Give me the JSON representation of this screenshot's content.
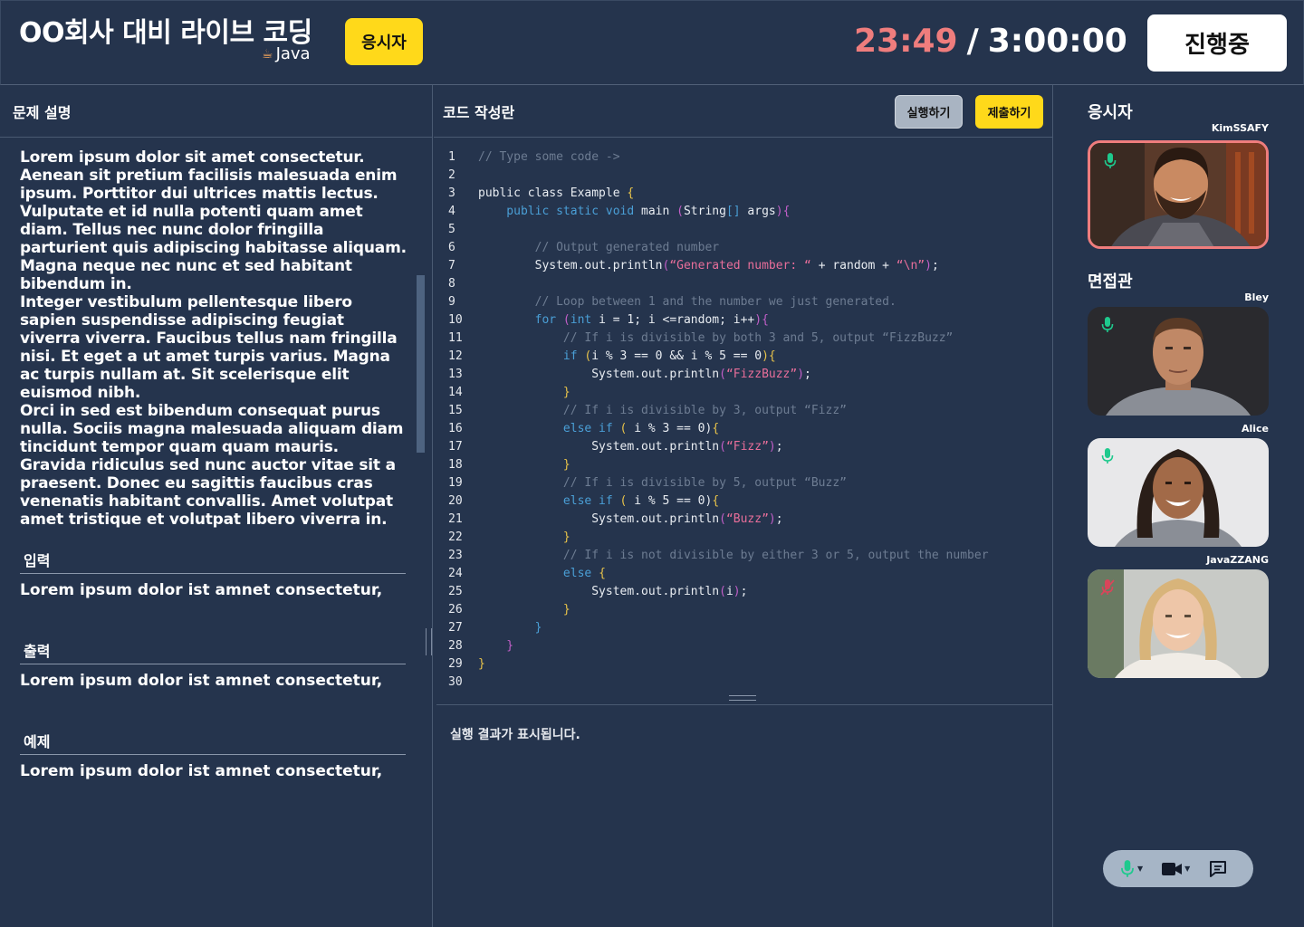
{
  "header": {
    "title": "OO회사 대비 라이브 코딩",
    "language": "Java",
    "role_badge": "응시자",
    "timer_elapsed": "23:49",
    "timer_sep": "/",
    "timer_total": "3:00:00",
    "status_label": "진행중"
  },
  "problem": {
    "heading": "문제 설명",
    "paragraphs": [
      "Lorem ipsum dolor sit amet consectetur. Aenean sit pretium facilisis malesuada enim ipsum. Porttitor dui ultrices mattis lectus. Vulputate et id nulla potenti quam amet diam. Tellus nec nunc dolor fringilla parturient quis adipiscing habitasse aliquam. Magna neque nec nunc et sed habitant bibendum in.",
      "Integer vestibulum pellentesque libero sapien suspendisse adipiscing feugiat viverra viverra. Faucibus tellus nam fringilla nisi. Et eget a ut amet turpis varius. Magna ac turpis nullam at. Sit scelerisque elit euismod nibh.",
      "Orci in sed est bibendum consequat purus nulla. Sociis magna malesuada aliquam diam tincidunt tempor quam quam mauris. Gravida ridiculus sed nunc auctor vitae sit a praesent. Donec eu sagittis faucibus cras venenatis habitant convallis. Amet volutpat amet tristique et volutpat libero viverra in."
    ],
    "input_title": "입력",
    "input_body": "Lorem ipsum dolor ist amnet consectetur,",
    "output_title": "출력",
    "output_body": "Lorem ipsum dolor ist amnet consectetur,",
    "example_title": "예제",
    "example_body": "Lorem ipsum dolor ist amnet consectetur,"
  },
  "editor": {
    "heading": "코드 작성란",
    "run_label": "실행하기",
    "submit_label": "제출하기",
    "lines": [
      [
        [
          "// Type some code ->",
          "comment"
        ]
      ],
      [],
      [
        [
          "public class Example ",
          "plain"
        ],
        [
          "{",
          "brace"
        ]
      ],
      [
        [
          "    public static void ",
          "kw"
        ],
        [
          "main ",
          "plain"
        ],
        [
          "(",
          "paren"
        ],
        [
          "String",
          "plain"
        ],
        [
          "[]",
          "kw"
        ],
        [
          " args",
          "plain"
        ],
        [
          "){",
          "paren"
        ]
      ],
      [],
      [
        [
          "        // Output generated number",
          "comment"
        ]
      ],
      [
        [
          "        System.out.println",
          "plain"
        ],
        [
          "(",
          "paren"
        ],
        [
          "“Generated number: “",
          "string"
        ],
        [
          " + random + ",
          "plain"
        ],
        [
          "“\\n”",
          "string"
        ],
        [
          ")",
          "paren"
        ],
        [
          ";",
          "plain"
        ]
      ],
      [],
      [
        [
          "        // Loop between 1 and the number we just generated.",
          "comment"
        ]
      ],
      [
        [
          "        for ",
          "kw"
        ],
        [
          "(",
          "paren"
        ],
        [
          "int ",
          "kw"
        ],
        [
          "i = 1; i <=random; i++",
          "plain"
        ],
        [
          "){",
          "paren"
        ]
      ],
      [
        [
          "            // If i is divisible by both 3 and 5, output “FizzBuzz”",
          "comment"
        ]
      ],
      [
        [
          "            if ",
          "kw"
        ],
        [
          "(",
          "brace"
        ],
        [
          "i % 3 == 0 && i % 5 == 0",
          "plain"
        ],
        [
          ")",
          "brace"
        ],
        [
          "{",
          "brace"
        ]
      ],
      [
        [
          "                System.out.println",
          "plain"
        ],
        [
          "(",
          "paren"
        ],
        [
          "“FizzBuzz”",
          "string"
        ],
        [
          ")",
          "paren"
        ],
        [
          ";",
          "plain"
        ]
      ],
      [
        [
          "            }",
          "brace"
        ]
      ],
      [
        [
          "            // If i is divisible by 3, output “Fizz”",
          "comment"
        ]
      ],
      [
        [
          "            else if ",
          "kw"
        ],
        [
          "( ",
          "brace"
        ],
        [
          "i % 3 == 0",
          "plain"
        ],
        [
          ")",
          "plain"
        ],
        [
          "{",
          "brace"
        ]
      ],
      [
        [
          "                System.out.println",
          "plain"
        ],
        [
          "(",
          "paren"
        ],
        [
          "“Fizz”",
          "string"
        ],
        [
          ")",
          "paren"
        ],
        [
          ";",
          "plain"
        ]
      ],
      [
        [
          "            }",
          "brace"
        ]
      ],
      [
        [
          "            // If i is divisible by 5, output “Buzz”",
          "comment"
        ]
      ],
      [
        [
          "            else if ",
          "kw"
        ],
        [
          "( ",
          "brace"
        ],
        [
          "i % 5 == 0",
          "plain"
        ],
        [
          ")",
          "plain"
        ],
        [
          "{",
          "brace"
        ]
      ],
      [
        [
          "                System.out.println",
          "plain"
        ],
        [
          "(",
          "paren"
        ],
        [
          "“Buzz”",
          "string"
        ],
        [
          ")",
          "paren"
        ],
        [
          ";",
          "plain"
        ]
      ],
      [
        [
          "            }",
          "brace"
        ]
      ],
      [
        [
          "            // If i is not divisible by either 3 or 5, output the number",
          "comment"
        ]
      ],
      [
        [
          "            else ",
          "kw"
        ],
        [
          "{",
          "brace"
        ]
      ],
      [
        [
          "                System.out.println",
          "plain"
        ],
        [
          "(",
          "paren"
        ],
        [
          "i",
          "plain"
        ],
        [
          ")",
          "paren"
        ],
        [
          ";",
          "plain"
        ]
      ],
      [
        [
          "            }",
          "brace"
        ]
      ],
      [
        [
          "        }",
          "kw"
        ]
      ],
      [
        [
          "    }",
          "paren"
        ]
      ],
      [
        [
          "}",
          "brace"
        ]
      ],
      []
    ],
    "output_text": "실행 결과가 표시됩니다."
  },
  "participants": {
    "candidate_title": "응시자",
    "interviewer_title": "면접관",
    "candidate": {
      "name": "KimSSAFY",
      "mic": "on"
    },
    "interviewers": [
      {
        "name": "Bley",
        "mic": "on"
      },
      {
        "name": "Alice",
        "mic": "on"
      },
      {
        "name": "JavaZZANG",
        "mic": "muted"
      }
    ]
  },
  "controls": {
    "icons": [
      "microphone-icon",
      "camera-icon",
      "chat-icon"
    ]
  },
  "colors": {
    "background": "#25344d",
    "accent_yellow": "#ffd91a",
    "timer_red": "#ef7d7d",
    "code_comment": "#6d7c92",
    "code_keyword": "#4a9fd6",
    "code_string": "#e86e9a",
    "code_brace": "#e8c34a",
    "code_paren": "#c25fc8",
    "mic_on": "#1ec98d",
    "mic_muted": "#d9455a"
  }
}
